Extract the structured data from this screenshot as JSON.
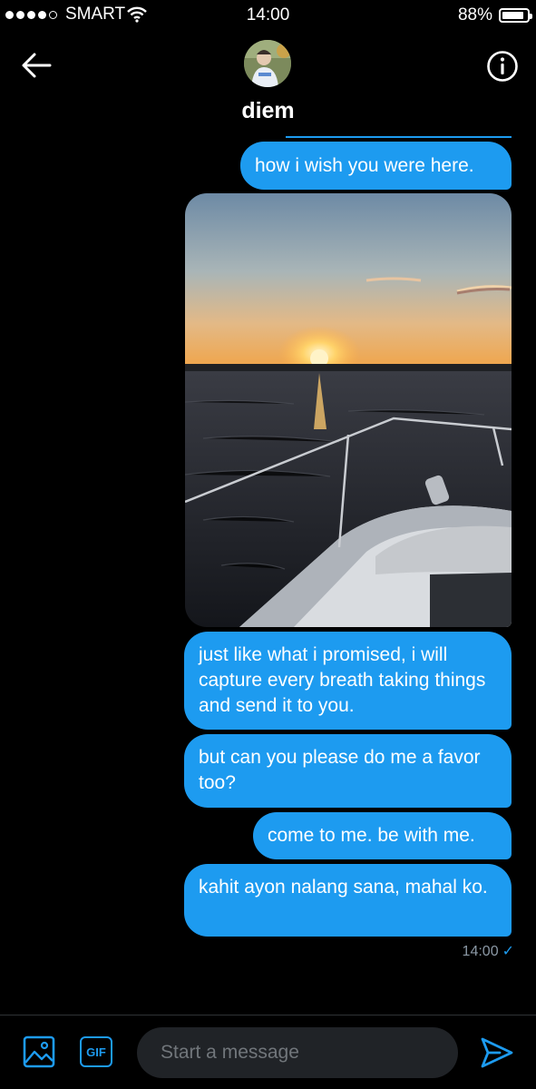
{
  "status_bar": {
    "carrier": "SMART",
    "time": "14:00",
    "battery": "88%",
    "battery_level": 0.88,
    "signal_bars": 4,
    "signal_total": 5
  },
  "header": {
    "contact_name": "diem",
    "back_icon": "arrow-left-icon",
    "info_icon": "info-icon"
  },
  "messages": [
    {
      "text": "how i wish you were here."
    },
    {
      "type": "image",
      "description_icon": "sunset-boat-photo"
    },
    {
      "text": "just like what i promised, i will capture every breath taking things and send it to you."
    },
    {
      "text": "but can you please do me a favor too?"
    },
    {
      "text": "come to me. be with me."
    },
    {
      "text": "kahit ayon nalang sana, mahal ko."
    }
  ],
  "timestamp": "14:00",
  "composer": {
    "placeholder": "Start a message",
    "gif_label": "GIF",
    "image_icon": "image-icon",
    "send_icon": "send-icon"
  },
  "colors": {
    "accent": "#1d9bf0",
    "background": "#000000",
    "input_bg": "#202327"
  }
}
